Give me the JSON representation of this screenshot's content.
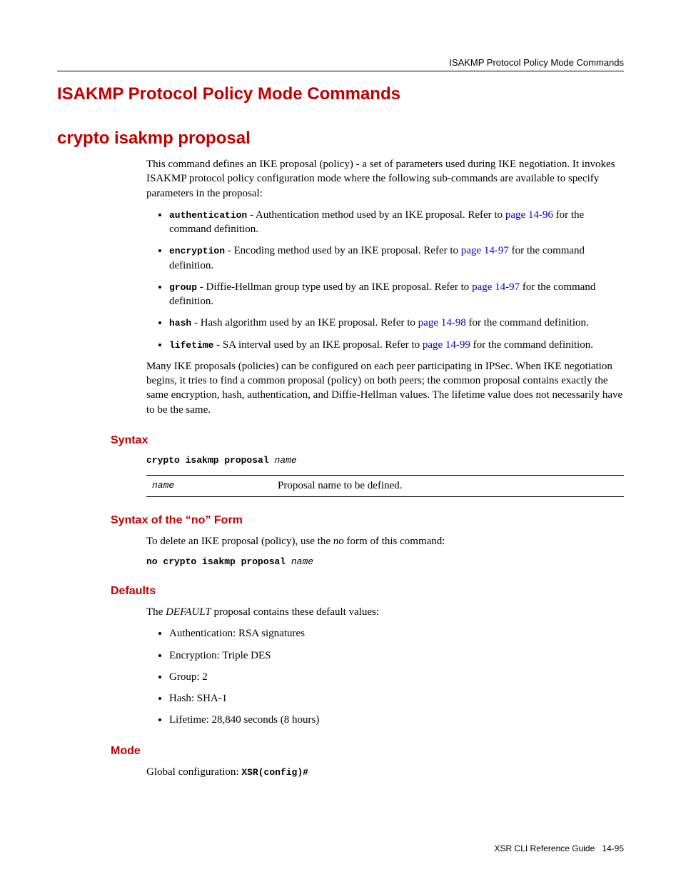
{
  "header": {
    "running_head": "ISAKMP Protocol Policy Mode Commands"
  },
  "section_title": "ISAKMP Protocol Policy Mode Commands",
  "command_title": "crypto isakmp proposal",
  "intro": "This command defines an IKE proposal (policy) - a set of parameters used during IKE negotiation. It invokes ISAKMP protocol policy configuration mode where the following sub-commands are available to specify parameters in the proposal:",
  "subs": [
    {
      "cmd": "authentication",
      "pre": " - Authentication method used by an IKE proposal. Refer to ",
      "link": "page 14-96",
      "post": " for the command definition."
    },
    {
      "cmd": "encryption",
      "pre": " - Encoding method used by an IKE proposal. Refer to ",
      "link": "page 14-97",
      "post": " for the command definition."
    },
    {
      "cmd": "group",
      "pre": " - Diffie-Hellman group type used by an IKE proposal. Refer to ",
      "link": "page 14-97",
      "post": " for the command definition."
    },
    {
      "cmd": "hash",
      "pre": " - Hash algorithm used by an IKE proposal. Refer to ",
      "link": "page 14-98",
      "post": " for the command definition."
    },
    {
      "cmd": "lifetime",
      "pre": " - SA interval used by an IKE proposal. Refer to ",
      "link": "page 14-99",
      "post": " for the command definition."
    }
  ],
  "intro2": "Many IKE proposals (policies) can be configured on each peer participating in IPSec. When IKE negotiation begins, it tries to find a common proposal (policy) on both peers; the common proposal contains exactly the same encryption, hash, authentication, and Diffie-Hellman values. The lifetime value does not necessarily have to be the same.",
  "syntax": {
    "heading": "Syntax",
    "line_cmd": "crypto isakmp proposal ",
    "line_arg": "name",
    "param_name": "name",
    "param_desc": "Proposal name to be defined."
  },
  "noform": {
    "heading": "Syntax of the “no” Form",
    "desc_pre": "To delete an IKE proposal (policy), use the ",
    "desc_em": "no",
    "desc_post": " form of this command:",
    "line_cmd": "no crypto isakmp proposal ",
    "line_arg": "name"
  },
  "defaults": {
    "heading": "Defaults",
    "intro_pre": "The ",
    "intro_em": "DEFAULT",
    "intro_post": " proposal contains these default values:",
    "items": [
      "Authentication: RSA signatures",
      "Encryption: Triple DES",
      "Group: 2",
      "Hash: SHA-1",
      "Lifetime: 28,840 seconds (8 hours)"
    ]
  },
  "mode": {
    "heading": "Mode",
    "pre": "Global configuration: ",
    "code": "XSR(config)#"
  },
  "footer": {
    "book": "XSR CLI Reference Guide",
    "page": "14-95"
  }
}
